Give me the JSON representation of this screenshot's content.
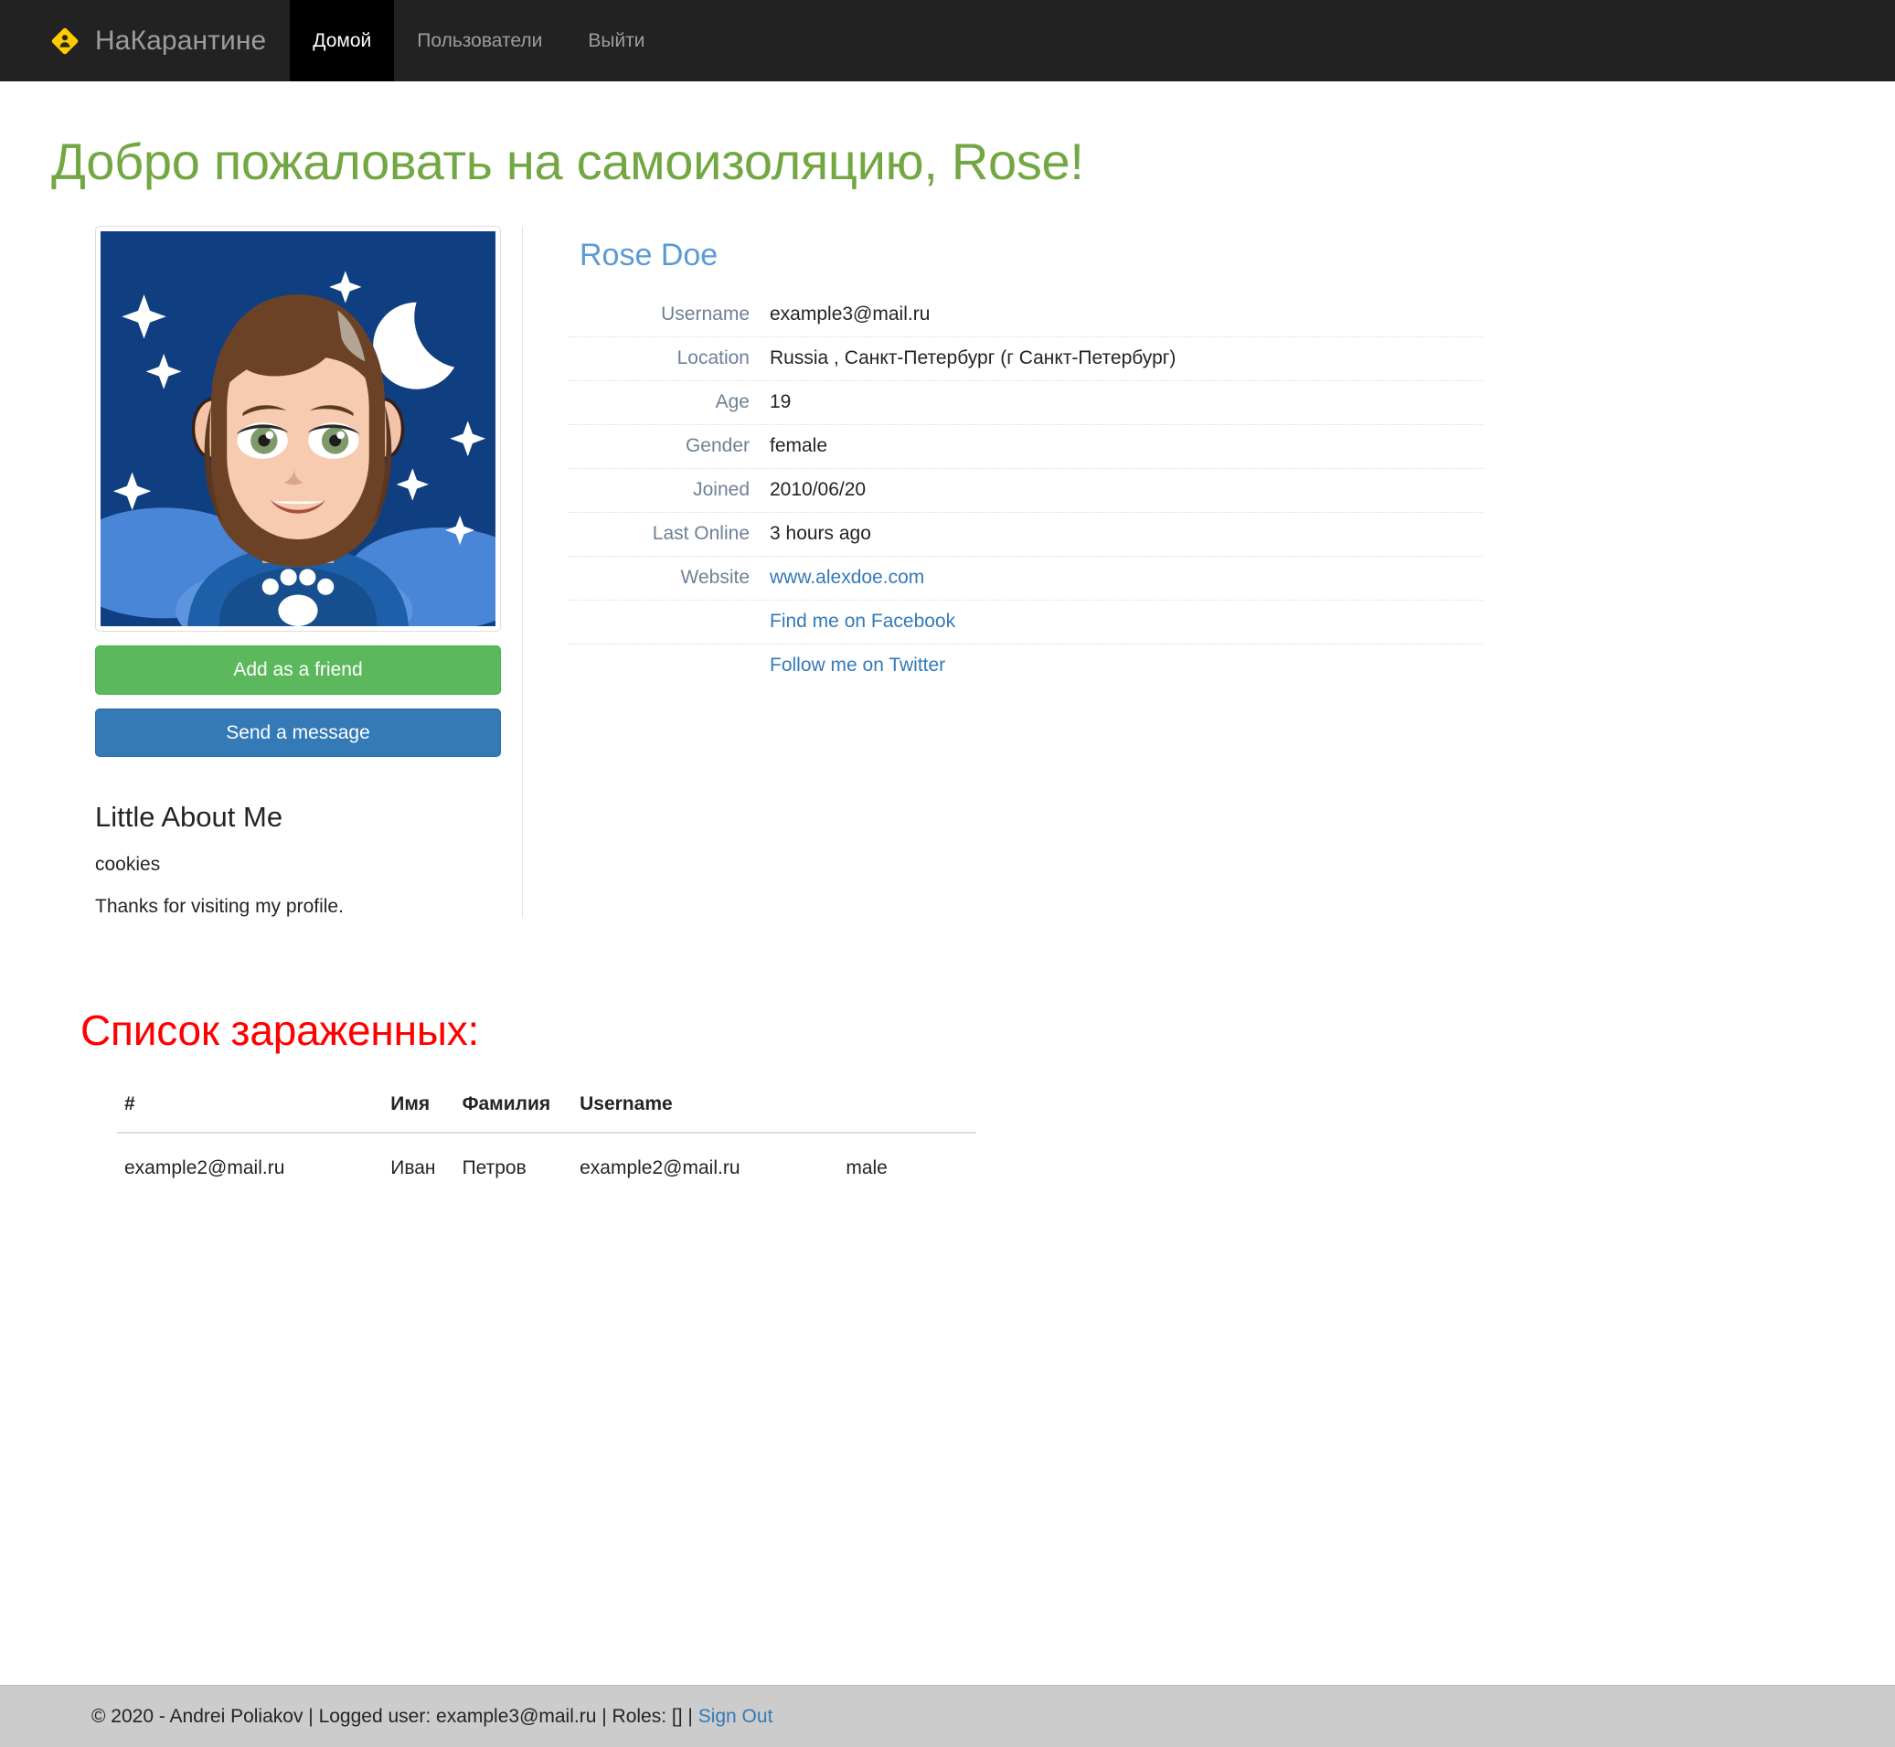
{
  "navbar": {
    "brand": "НаКарантине",
    "brand_icon": "user-diamond-icon",
    "links": [
      {
        "label": "Домой",
        "active": true
      },
      {
        "label": "Пользователи",
        "active": false
      },
      {
        "label": "Выйти",
        "active": false
      }
    ]
  },
  "page": {
    "title": "Добро пожаловать на самоизоляцию, Rose!"
  },
  "profile": {
    "avatar_alt": "girl-avatar-night-sky",
    "name": "Rose Doe",
    "buttons": {
      "add_friend": "Add as a friend",
      "send_message": "Send a message"
    },
    "details": [
      {
        "term": "Username",
        "value": "example3@mail.ru",
        "link": false
      },
      {
        "term": "Location",
        "value": "Russia , Санкт-Петербург (г Санкт-Петербург)",
        "link": false
      },
      {
        "term": "Age",
        "value": "19",
        "link": false
      },
      {
        "term": "Gender",
        "value": "female",
        "link": false
      },
      {
        "term": "Joined",
        "value": "2010/06/20",
        "link": false
      },
      {
        "term": "Last Online",
        "value": "3 hours ago",
        "link": false
      },
      {
        "term": "Website",
        "value": "www.alexdoe.com",
        "link": true
      },
      {
        "term": "",
        "value": "Find me on Facebook",
        "link": true
      },
      {
        "term": "",
        "value": "Follow me on Twitter",
        "link": true
      }
    ],
    "about": {
      "heading": "Little About Me",
      "line1": "cookies",
      "line2": "Thanks for visiting my profile."
    }
  },
  "infected": {
    "title": "Список зараженных:",
    "columns": [
      "#",
      "Имя",
      "Фамилия",
      "Username",
      ""
    ],
    "rows": [
      {
        "id": "example2@mail.ru",
        "first_name": "Иван",
        "last_name": "Петров",
        "username": "example2@mail.ru",
        "gender": "male"
      }
    ]
  },
  "footer": {
    "copyright": "© 2020 - Andrei Poliakov",
    "sep1": " | ",
    "logged_user": "Logged user: example3@mail.ru",
    "sep2": " | ",
    "roles": "Roles: []",
    "sep3": " | ",
    "sign_out": "Sign Out"
  },
  "colors": {
    "navbar_bg": "#222222",
    "nav_active_bg": "#000000",
    "brand_yellow": "#FFCC00",
    "title_green": "#73a743",
    "infected_red": "#ff0000",
    "link_blue": "#337ab7",
    "name_blue": "#5b9bd5",
    "btn_success": "#5cb85c",
    "btn_primary": "#337ab7",
    "footer_bg": "#cccccc"
  }
}
